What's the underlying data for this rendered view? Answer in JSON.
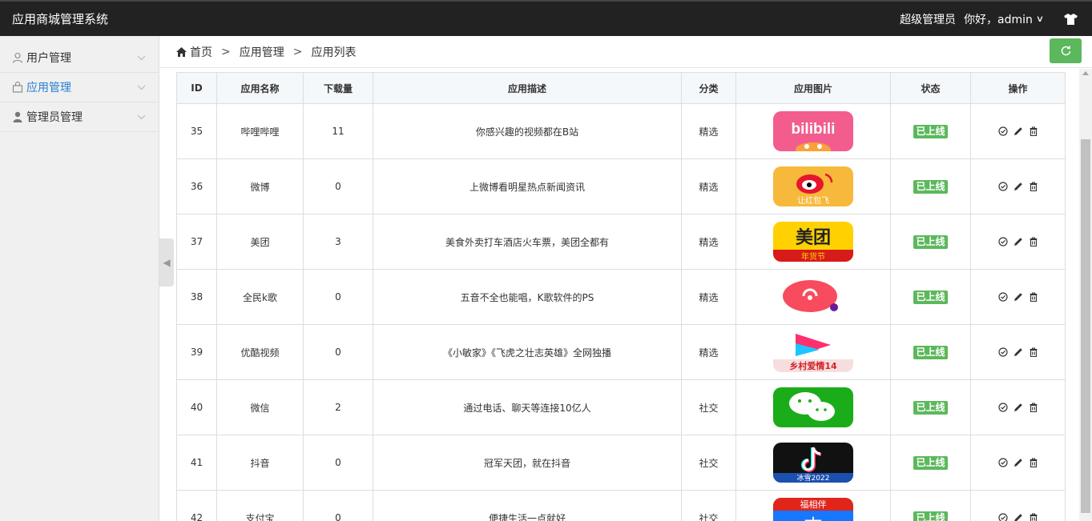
{
  "app": {
    "title": "应用商城管理系统"
  },
  "topbar": {
    "role": "超级管理员",
    "greeting": "你好，admin"
  },
  "sidebar": {
    "items": [
      {
        "label": "用户管理",
        "icon": "user-outline-icon",
        "active": false
      },
      {
        "label": "应用管理",
        "icon": "shopping-bag-icon",
        "active": true
      },
      {
        "label": "管理员管理",
        "icon": "user-solid-icon",
        "active": false
      }
    ]
  },
  "breadcrumb": {
    "home": "首页",
    "level1": "应用管理",
    "level2": "应用列表",
    "separator": ">"
  },
  "table": {
    "headers": [
      "ID",
      "应用名称",
      "下载量",
      "应用描述",
      "分类",
      "应用图片",
      "状态",
      "操作"
    ],
    "rows": [
      {
        "id": "35",
        "name": "哔哩哔哩",
        "downloads": "11",
        "desc": "你感兴趣的视频都在B站",
        "category": "精选",
        "image": "bilibili-logo",
        "status": "已上线"
      },
      {
        "id": "36",
        "name": "微博",
        "downloads": "0",
        "desc": "上微博看明星热点新闻资讯",
        "category": "精选",
        "image": "weibo-logo",
        "status": "已上线"
      },
      {
        "id": "37",
        "name": "美团",
        "downloads": "3",
        "desc": "美食外卖打车酒店火车票，美团全都有",
        "category": "精选",
        "image": "meituan-logo",
        "status": "已上线"
      },
      {
        "id": "38",
        "name": "全民k歌",
        "downloads": "0",
        "desc": "五音不全也能唱，K歌软件的PS",
        "category": "精选",
        "image": "kge-logo",
        "status": "已上线"
      },
      {
        "id": "39",
        "name": "优酷视频",
        "downloads": "0",
        "desc": "《小敏家》《飞虎之壮志英雄》全网独播",
        "category": "精选",
        "image": "youku-logo",
        "status": "已上线"
      },
      {
        "id": "40",
        "name": "微信",
        "downloads": "2",
        "desc": "通过电话、聊天等连接10亿人",
        "category": "社交",
        "image": "wechat-logo",
        "status": "已上线"
      },
      {
        "id": "41",
        "name": "抖音",
        "downloads": "0",
        "desc": "冠军天团，就在抖音",
        "category": "社交",
        "image": "douyin-logo",
        "status": "已上线"
      },
      {
        "id": "42",
        "name": "支付宝",
        "downloads": "0",
        "desc": "便捷生活一点就好",
        "category": "社交",
        "image": "alipay-logo",
        "status": "已上线"
      }
    ]
  },
  "logo_text": {
    "bilibili": "bilibili",
    "weibo": "让红包飞",
    "meituan": "美团",
    "meituan_sub": "年货节",
    "youku": "乡村爱情14",
    "douyin": "冰雪2022",
    "alipay_top": "福相伴",
    "alipay_main": "支"
  },
  "colors": {
    "topbar": "#222222",
    "accent": "#2a7ed2",
    "success": "#5cb85c",
    "sidebar": "#f0f0f0"
  }
}
